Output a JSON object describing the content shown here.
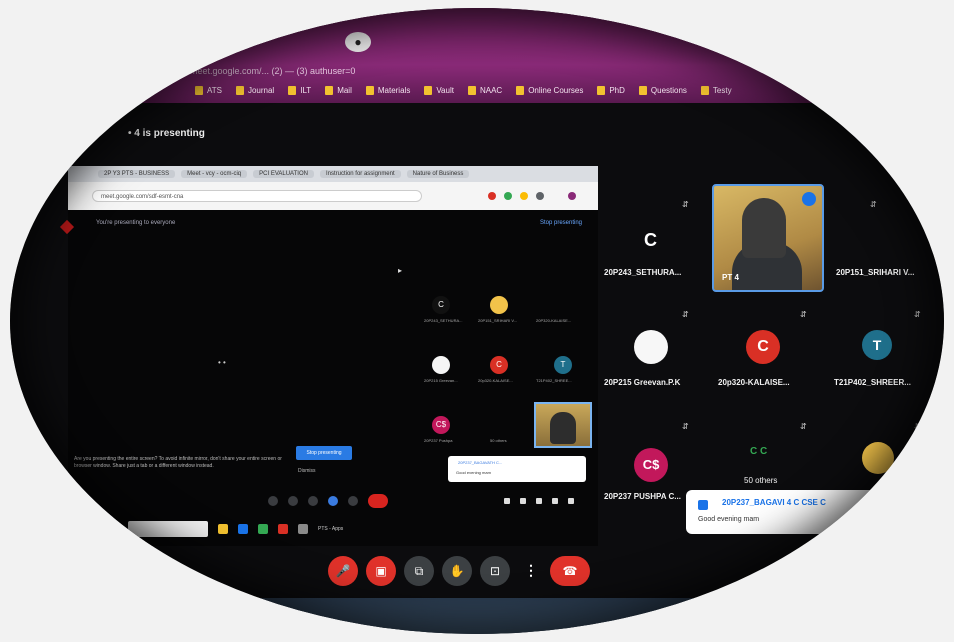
{
  "browser": {
    "tab_icon": "meet-tab-icon",
    "url_text": "meet.google.com/... (2) — (3) authuser=0",
    "bookmarks": [
      "ATS",
      "Journal",
      "ILT",
      "Mail",
      "Materials",
      "Vault",
      "NAAC",
      "Online Courses",
      "PhD",
      "Questions",
      "Testy"
    ]
  },
  "presenting": {
    "text": "• 4 is presenting"
  },
  "shared_screen": {
    "chrome_tabs": [
      "2P Y3 PTS - BUSINESS",
      "Meet - vcy - ocm-ciq",
      "PCI EVALUATION",
      "Instruction for assignment",
      "Nature of Business"
    ],
    "address": "meet.google.com/sdf-esmt-cna",
    "inner_title": "You're presenting to everyone",
    "inner_stop": "Stop presenting",
    "banner": "Are you presenting the entire screen? To avoid infinite mirror, don't share your entire screen or browser window. Share just a tab or a different window instead.",
    "stop_button": "Stop presenting",
    "dismiss": "Dismiss",
    "mini_toast_title": "20P237_BAGAVATH C...",
    "mini_toast_msg": "Good evening mam",
    "mini_participants": [
      {
        "letter": "C",
        "label": "20P243_SETHURA..."
      },
      {
        "letter": "",
        "label": "20P151_SRIHARI V..."
      },
      {
        "letter": "",
        "label": "20P320-KALAISE..."
      },
      {
        "letter": "",
        "label": "20P215 Greevan..."
      },
      {
        "letter": "C",
        "label": "20p320-KALAISE..."
      },
      {
        "letter": "T",
        "label": "T21P402_SHREE..."
      },
      {
        "letter": "C$",
        "label": "20P237 Pushpa"
      },
      {
        "letter": "",
        "label": "50 others"
      }
    ],
    "taskbar_label": "PTS - Apps"
  },
  "grid": {
    "tiles": [
      {
        "letter": "C",
        "name": "20P243_SETHURA..."
      },
      {
        "letter": "",
        "name": "PT 4"
      },
      {
        "letter": "",
        "name": "20P151_SRIHARI V..."
      },
      {
        "letter": "",
        "name": "20P215 Greevan.P.K"
      },
      {
        "letter": "C",
        "name": "20p320-KALAISE..."
      },
      {
        "letter": "T",
        "name": "T21P402_SHREER..."
      },
      {
        "letter": "C$",
        "name": "20P237 PUSHPA C..."
      },
      {
        "letter": "C C",
        "name": "50 others"
      }
    ]
  },
  "toast": {
    "name": "20P237_BAGAVI 4 C CSE C",
    "message": "Good evening mam"
  },
  "controls": {
    "mic_icon": "mic-off-icon",
    "cam_icon": "camera-off-icon",
    "captions_icon": "captions-icon",
    "hand_icon": "raise-hand-icon",
    "present_icon": "present-icon",
    "more": "⋮",
    "end_icon": "end-call-icon"
  },
  "colors": {
    "accent_red": "#e0322a",
    "meet_blue": "#1a73e8",
    "avatar_red": "#d93025",
    "avatar_pink": "#c2185b",
    "avatar_teal": "#1f6f8b"
  }
}
